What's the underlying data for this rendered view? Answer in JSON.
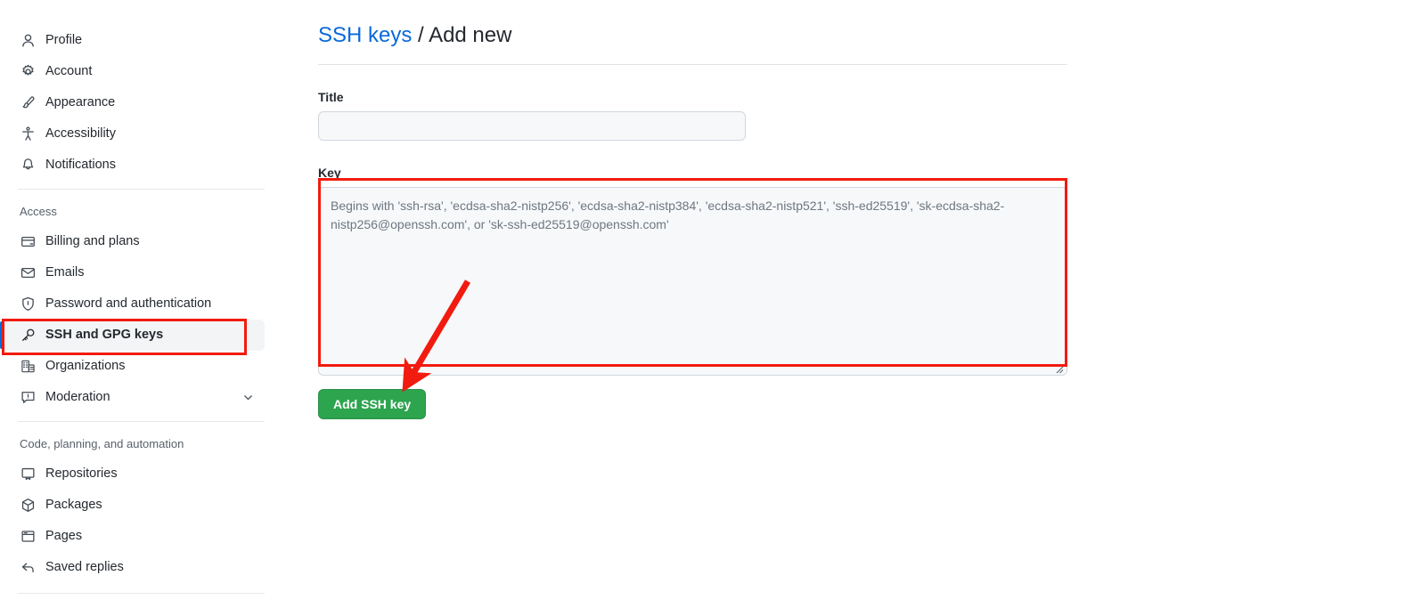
{
  "sidebar": {
    "primary_items": [
      {
        "label": "Profile",
        "icon": "person-icon"
      },
      {
        "label": "Account",
        "icon": "gear-icon"
      },
      {
        "label": "Appearance",
        "icon": "paintbrush-icon"
      },
      {
        "label": "Accessibility",
        "icon": "accessibility-icon"
      },
      {
        "label": "Notifications",
        "icon": "bell-icon"
      }
    ],
    "access_section": {
      "title": "Access",
      "items": [
        {
          "label": "Billing and plans",
          "icon": "credit-card-icon"
        },
        {
          "label": "Emails",
          "icon": "mail-icon"
        },
        {
          "label": "Password and authentication",
          "icon": "shield-lock-icon"
        },
        {
          "label": "SSH and GPG keys",
          "icon": "key-icon",
          "active": true
        },
        {
          "label": "Organizations",
          "icon": "organization-icon"
        },
        {
          "label": "Moderation",
          "icon": "report-icon",
          "expandable": true
        }
      ]
    },
    "code_section": {
      "title": "Code, planning, and automation",
      "items": [
        {
          "label": "Repositories",
          "icon": "repo-icon"
        },
        {
          "label": "Packages",
          "icon": "package-icon"
        },
        {
          "label": "Pages",
          "icon": "browser-icon"
        },
        {
          "label": "Saved replies",
          "icon": "reply-icon"
        }
      ]
    }
  },
  "main": {
    "heading_link": "SSH keys",
    "heading_separator": " / ",
    "heading_current": "Add new",
    "title_label": "Title",
    "title_value": "",
    "title_placeholder": "",
    "key_label": "Key",
    "key_value": "",
    "key_placeholder": "Begins with 'ssh-rsa', 'ecdsa-sha2-nistp256', 'ecdsa-sha2-nistp384', 'ecdsa-sha2-nistp521', 'ssh-ed25519', 'sk-ecdsa-sha2-nistp256@openssh.com', or 'sk-ssh-ed25519@openssh.com'",
    "submit_label": "Add SSH key"
  },
  "annotations": {
    "color": "#f21b0f",
    "highlight_sidebar_item": "SSH and GPG keys",
    "arrow_target": "Add SSH key"
  },
  "colors": {
    "accent_link": "#0969da",
    "submit_green": "#2da44e",
    "annotation_red": "#f21b0f",
    "active_nav_bg": "#f3f4f6",
    "input_bg": "#f6f8fa"
  }
}
